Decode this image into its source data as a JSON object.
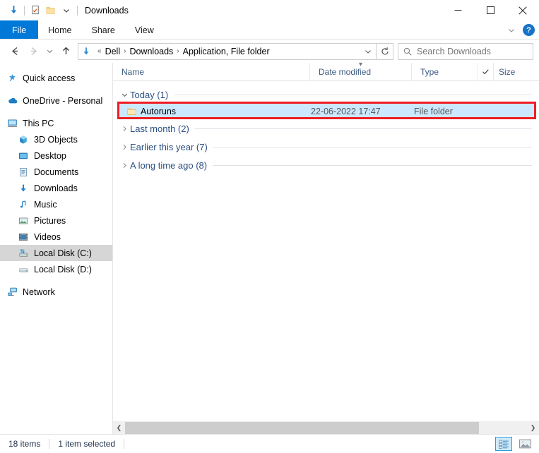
{
  "window": {
    "title": "Downloads",
    "quick_access": [
      {
        "name": "download-icon",
        "label": "Downloads"
      },
      {
        "name": "properties-icon",
        "label": "Properties"
      },
      {
        "name": "new-folder-icon",
        "label": "New folder"
      },
      {
        "name": "chevron-down-icon",
        "label": "Customize Quick Access Toolbar"
      }
    ],
    "controls": {
      "minimize": "Minimize",
      "maximize": "Maximize",
      "close": "Close"
    }
  },
  "ribbon": {
    "tabs": [
      {
        "label": "File",
        "active": true
      },
      {
        "label": "Home",
        "active": false
      },
      {
        "label": "Share",
        "active": false
      },
      {
        "label": "View",
        "active": false
      }
    ],
    "collapse_label": "Minimize the Ribbon",
    "help_label": "?"
  },
  "address": {
    "back_label": "Back",
    "forward_label": "Forward",
    "recent_label": "Recent locations",
    "up_label": "Up",
    "breadcrumb_icon": "download-icon",
    "overflow": "«",
    "crumbs": [
      "Dell",
      "Downloads",
      "Application, File folder"
    ],
    "separator": "›",
    "dropdown_label": "Previous locations",
    "refresh_label": "Refresh"
  },
  "search": {
    "placeholder": "Search Downloads",
    "value": "",
    "icon": "search-icon"
  },
  "sidebar": {
    "items": [
      {
        "label": "Quick access",
        "icon": "star-pin-icon",
        "indent": false,
        "selected": false,
        "gap_before": false
      },
      {
        "label": "OneDrive - Personal",
        "icon": "cloud-icon",
        "indent": false,
        "selected": false,
        "gap_before": true
      },
      {
        "label": "This PC",
        "icon": "monitor-icon",
        "indent": false,
        "selected": false,
        "gap_before": true
      },
      {
        "label": "3D Objects",
        "icon": "3d-objects-icon",
        "indent": true,
        "selected": false,
        "gap_before": false
      },
      {
        "label": "Desktop",
        "icon": "desktop-icon",
        "indent": true,
        "selected": false,
        "gap_before": false
      },
      {
        "label": "Documents",
        "icon": "documents-icon",
        "indent": true,
        "selected": false,
        "gap_before": false
      },
      {
        "label": "Downloads",
        "icon": "download-icon",
        "indent": true,
        "selected": false,
        "gap_before": false
      },
      {
        "label": "Music",
        "icon": "music-icon",
        "indent": true,
        "selected": false,
        "gap_before": false
      },
      {
        "label": "Pictures",
        "icon": "pictures-icon",
        "indent": true,
        "selected": false,
        "gap_before": false
      },
      {
        "label": "Videos",
        "icon": "videos-icon",
        "indent": true,
        "selected": false,
        "gap_before": false
      },
      {
        "label": "Local Disk (C:)",
        "icon": "drive-system-icon",
        "indent": true,
        "selected": true,
        "gap_before": false
      },
      {
        "label": "Local Disk (D:)",
        "icon": "drive-icon",
        "indent": true,
        "selected": false,
        "gap_before": false
      },
      {
        "label": "Network",
        "icon": "network-icon",
        "indent": false,
        "selected": false,
        "gap_before": true
      }
    ]
  },
  "columns": [
    {
      "label": "Name",
      "key": "name"
    },
    {
      "label": "Date modified",
      "key": "date",
      "sorted": true
    },
    {
      "label": "Type",
      "key": "type"
    },
    {
      "label": "Size",
      "key": "size"
    }
  ],
  "groups": [
    {
      "label": "Today (1)",
      "expanded": true,
      "rows": [
        {
          "name": "Autoruns",
          "date": "22-06-2022 17:47",
          "type": "File folder",
          "size": "",
          "icon": "folder-icon",
          "selected": true,
          "highlighted": true
        }
      ]
    },
    {
      "label": "Last month (2)",
      "expanded": false,
      "rows": []
    },
    {
      "label": "Earlier this year (7)",
      "expanded": false,
      "rows": []
    },
    {
      "label": "A long time ago (8)",
      "expanded": false,
      "rows": []
    }
  ],
  "statusbar": {
    "item_count": "18 items",
    "selection": "1 item selected",
    "views": [
      {
        "name": "details-view-button",
        "active": true
      },
      {
        "name": "large-icons-view-button",
        "active": false
      }
    ]
  },
  "colors": {
    "accent": "#0078d7",
    "selection": "#cce8ff",
    "annotation": "#ee1d23",
    "group_label": "#2c4f82",
    "column_header": "#3c5a80",
    "folder": "#ffd67a"
  }
}
